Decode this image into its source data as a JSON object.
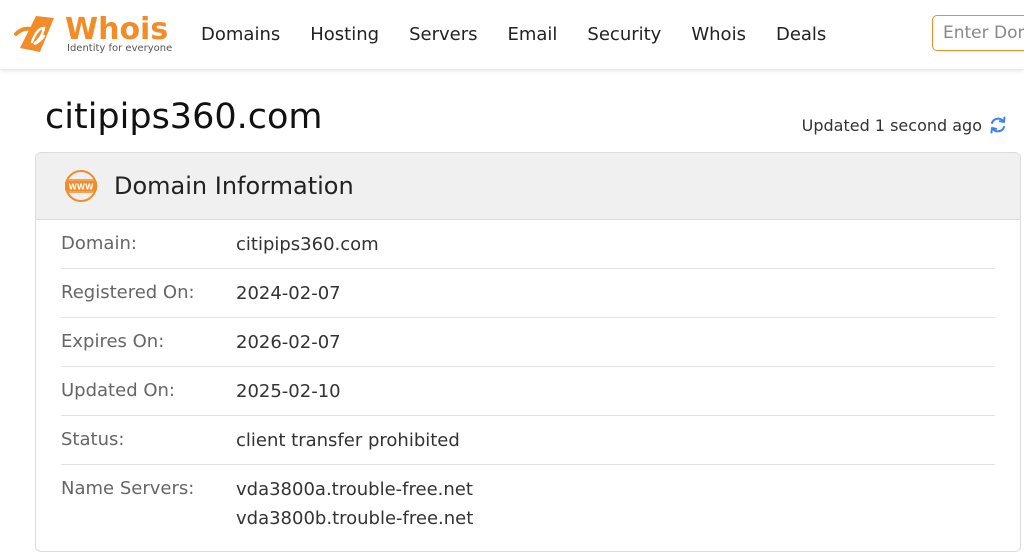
{
  "brand": {
    "name": "Whois",
    "tagline": "Identity for everyone",
    "color": "#f28c28"
  },
  "nav": {
    "items": [
      "Domains",
      "Hosting",
      "Servers",
      "Email",
      "Security",
      "Whois",
      "Deals"
    ]
  },
  "search": {
    "placeholder": "Enter Domain"
  },
  "page": {
    "title": "citipips360.com",
    "updated_text": "Updated 1 second ago",
    "refresh_icon": "refresh-icon"
  },
  "domain_info": {
    "heading": "Domain Information",
    "icon": "www-icon",
    "rows": [
      {
        "label": "Domain:",
        "value": "citipips360.com"
      },
      {
        "label": "Registered On:",
        "value": "2024-02-07"
      },
      {
        "label": "Expires On:",
        "value": "2026-02-07"
      },
      {
        "label": "Updated On:",
        "value": "2025-02-10"
      },
      {
        "label": "Status:",
        "value": "client transfer prohibited"
      },
      {
        "label": "Name Servers:",
        "values": [
          "vda3800a.trouble-free.net",
          "vda3800b.trouble-free.net"
        ]
      }
    ]
  }
}
